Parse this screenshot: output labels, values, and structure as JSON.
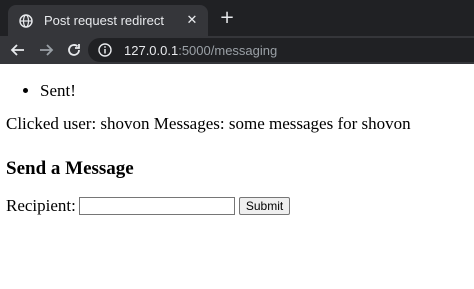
{
  "browser": {
    "tab_title": "Post request redirect",
    "tab_favicon": "globe-icon",
    "close_icon": "close-icon",
    "new_tab_icon": "plus-icon",
    "url_host": "127.0.0.1",
    "url_rest": ":5000/messaging"
  },
  "page": {
    "flash_messages": [
      "Sent!"
    ],
    "clicked_user_text": "Clicked user: shovon Messages: some messages for shovon",
    "heading": "Send a Message",
    "form": {
      "recipient_label": "Recipient:",
      "recipient_value": "",
      "submit_label": "Submit"
    }
  },
  "colors": {
    "chrome_dark": "#202124",
    "toolbar": "#35363a",
    "tab_text": "#e8eaed",
    "url_dim": "#9aa0a6"
  }
}
